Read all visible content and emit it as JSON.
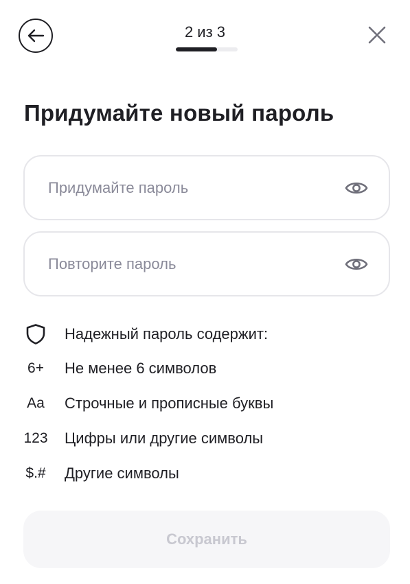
{
  "header": {
    "step_text": "2 из 3",
    "progress_fraction": 0.67
  },
  "title": "Придумайте новый пароль",
  "fields": [
    {
      "placeholder": "Придумайте пароль",
      "value": ""
    },
    {
      "placeholder": "Повторите пароль",
      "value": ""
    }
  ],
  "requirements": {
    "header": {
      "icon": "shield-icon",
      "text": "Надежный пароль содержит:"
    },
    "items": [
      {
        "badge": "6+",
        "text": "Не менее 6 символов"
      },
      {
        "badge": "Aa",
        "text": "Строчные и прописные буквы"
      },
      {
        "badge": "123",
        "text": "Цифры или другие символы"
      },
      {
        "badge": "$.#",
        "text": "Другие символы"
      }
    ]
  },
  "save_button": {
    "label": "Сохранить"
  },
  "icons": {
    "back": "arrow-left-icon",
    "close": "close-icon",
    "eye": "eye-icon"
  },
  "colors": {
    "text": "#1f1f24",
    "placeholder": "#8a8a99",
    "field_border": "#e6e6ea",
    "button_disabled_bg": "#f6f6f8",
    "button_disabled_text": "#c8c8d0"
  }
}
